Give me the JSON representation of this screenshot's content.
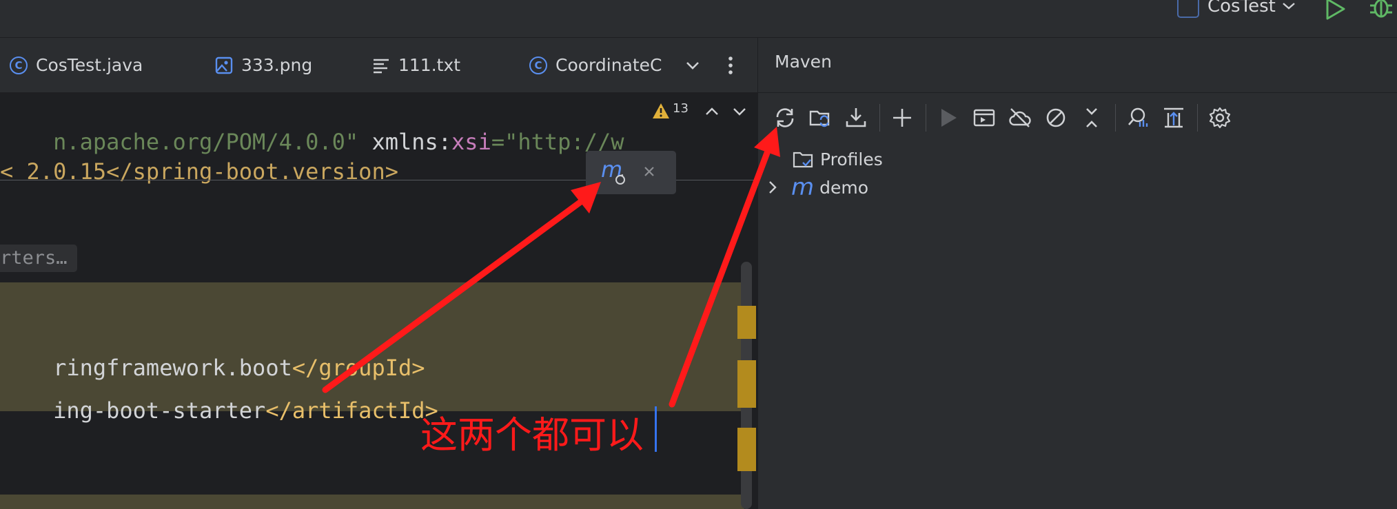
{
  "title_bar": {
    "run_config_label": "CosTest"
  },
  "editor_tabs": [
    {
      "label": "CosTest.java",
      "icon": "class-icon"
    },
    {
      "label": "333.png",
      "icon": "image-file-icon"
    },
    {
      "label": "111.txt",
      "icon": "text-file-icon"
    },
    {
      "label": "CoordinateC",
      "icon": "class-icon"
    }
  ],
  "editor": {
    "line1": {
      "a": "n.apache.org/POM/4.0.0\" ",
      "b": "xmlns",
      "c": ":",
      "d": "xsi",
      "e": "=\"http://w"
    },
    "warning_count": "13",
    "line2_partial": "< 2.0.15</spring-boot.version>",
    "folded_text": "rters…",
    "line3": {
      "a": "ringframework.boot",
      "b": "</groupId>"
    },
    "line4": {
      "a": "ing-boot-starter",
      "b": "</artifactId>"
    }
  },
  "annotation": {
    "text": "这两个都可以",
    "color": "#ff1a1a"
  },
  "maven": {
    "title": "Maven",
    "tree": [
      {
        "label": "Profiles",
        "icon": "folder-icon"
      },
      {
        "label": "demo",
        "icon": "maven-module-icon"
      }
    ]
  },
  "colors": {
    "keyword_string_green": "#6a8759",
    "tag_gold": "#e8bf6a",
    "attr_purple": "#c77dbb",
    "highlight_bg": "#4b4834",
    "accent_blue": "#3574f0",
    "run_green": "#5fb865"
  }
}
